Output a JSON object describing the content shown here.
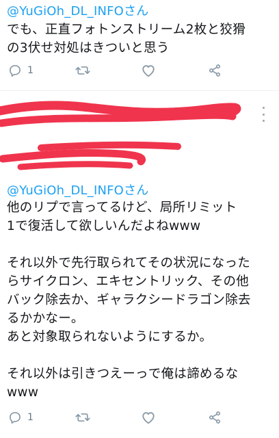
{
  "first_reply": {
    "mention": "@YuGiOh_DL_INFOさん",
    "text": "でも、正直フォトンストリーム2枚と狡猾\nの3伏せ対処はきついと思う",
    "reply_count": "1"
  },
  "second_reply": {
    "mention": "@YuGiOh_DL_INFOさん",
    "text": "他のリプで言ってるけど、局所リミット\n1で復活して欲しいんだよねwww\n\nそれ以外で先行取られてその状況になった\nらサイクロン、エキセントリック、その他\nバック除去か、ギャラクシードラゴン除去\nるかかなー。\nあと対象取られないようにするか。\n\nそれ以外は引きつえーっで俺は諦めるな\nwww",
    "reply_count": "1"
  },
  "colors": {
    "link": "#1da1f2",
    "icon": "#8899a6",
    "redaction": "#f0344d"
  }
}
